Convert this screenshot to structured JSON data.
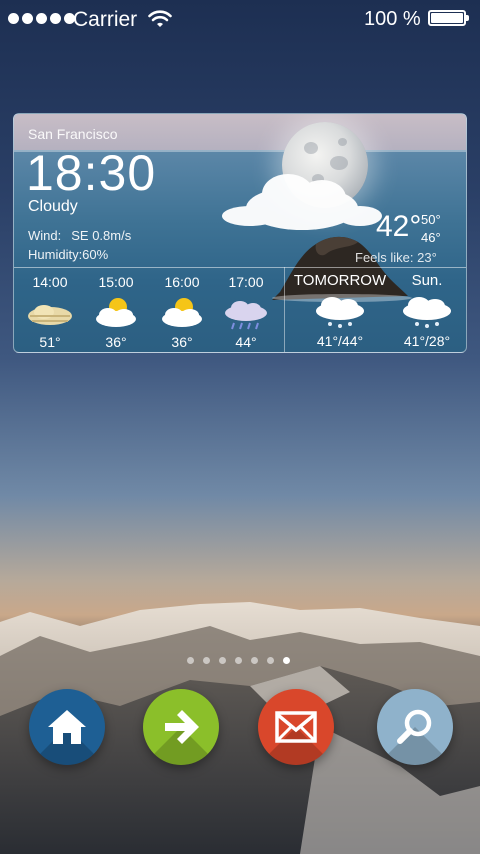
{
  "status_bar": {
    "carrier": "Carrier",
    "battery_percent": "100 %",
    "signal_bars": 5,
    "battery_level": 1.0
  },
  "weather_widget": {
    "city": "San Francisco",
    "time": "18:30",
    "condition": "Cloudy",
    "wind_label": "Wind:",
    "wind_value": "SE 0.8m/s",
    "humidity": "Humidity:60%",
    "current_temp": "42°",
    "high": "50°",
    "low": "46°",
    "feels_like": "Feels like: 23°",
    "hourly": [
      {
        "time": "14:00",
        "icon": "partly-sunny-hazy-icon",
        "temp": "51°"
      },
      {
        "time": "15:00",
        "icon": "sun-cloud-icon",
        "temp": "36°"
      },
      {
        "time": "16:00",
        "icon": "sun-cloud-icon",
        "temp": "36°"
      },
      {
        "time": "17:00",
        "icon": "rain-cloud-icon",
        "temp": "44°"
      }
    ],
    "daily": [
      {
        "day": "TOMORROW",
        "icon": "snow-cloud-icon",
        "temp": "41°/44°"
      },
      {
        "day": "Sun.",
        "icon": "snow-cloud-icon",
        "temp": "41°/28°"
      }
    ]
  },
  "pager": {
    "count": 7,
    "active_index": 6
  },
  "dock": [
    {
      "name": "home",
      "icon": "home-icon",
      "color": "#1e5f94"
    },
    {
      "name": "forward",
      "icon": "arrow-right-icon",
      "color": "#8bbf2a"
    },
    {
      "name": "mail",
      "icon": "envelope-icon",
      "color": "#d9472b"
    },
    {
      "name": "search",
      "icon": "magnifier-icon",
      "color": "#8fb2cb"
    }
  ]
}
